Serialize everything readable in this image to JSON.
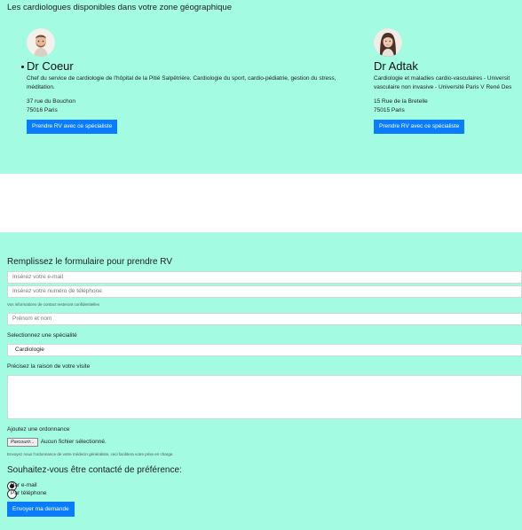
{
  "intro": "Les cardiologues disponibles dans votre zone géographique",
  "doctors": [
    {
      "name": "Dr Coeur",
      "description": "Chef du service de cardiologie de l'hôpital de la Pitié Salpêtrière. Cardiologie du sport, cardio-pédiatrie, gestion du stress, méditation.",
      "street": "37 rue du Bouchon",
      "city": "75016 Paris",
      "button": "Prendre RV avec ce spécialiste"
    },
    {
      "name": "Dr Adtak",
      "description_line1": "Cardiologie et maladies cardio-vasculaires - Universit",
      "description_line2": "vasculaire non invasive - Université Paris V René Des",
      "street": "15 Rue de la Bretelle",
      "city": "75015 Paris",
      "button": "Prendre RV avec ce spécialiste"
    }
  ],
  "form": {
    "title": "Remplissez le formulaire pour prendre RV",
    "email_placeholder": "Insérez votre e-mail",
    "phone_placeholder": "Insérez votre numéro de téléphone",
    "privacy_hint": "Vos informations de contact resteront confidentielles",
    "name_placeholder": "Prénom et nom",
    "specialty_label": "Selectionnez une spécialité",
    "specialty_value": "Cardiologie",
    "reason_label": "Précisez la raison de votre visite",
    "prescription_label": "Ajoutez une ordonnance",
    "file_button": "Parcourir...",
    "file_status": "Aucun fichier sélectionné.",
    "prescription_hint": "Envoyez nous l'ordonnance de votre médecin généraliste, ceci facilitera votre prise en charge.",
    "preference_title": "Souhaitez-vous être contacté de préférence:",
    "option_email": "Par e-mail",
    "option_phone": "Par téléphone",
    "submit": "Envoyer ma demande"
  },
  "colors": {
    "background": "#a3fbe1",
    "accent": "#0a7cff"
  }
}
